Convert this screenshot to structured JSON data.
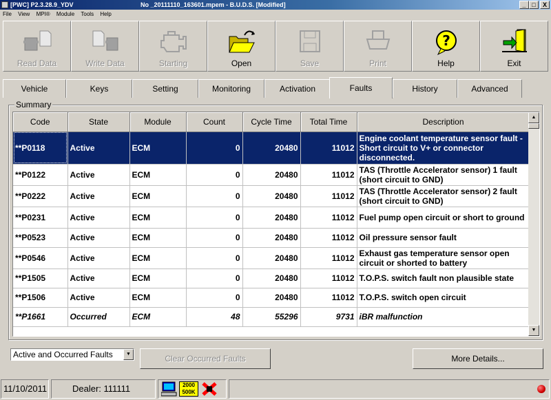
{
  "window": {
    "title_app": "[PWC] P2.3.28.9_YDV",
    "title_file": "No _20111110_163601.mpem - B.U.D.S. [Modified]",
    "controls": [
      "_",
      "□",
      "X"
    ]
  },
  "menu": [
    "File",
    "View",
    "MPI®",
    "Module",
    "Tools",
    "Help"
  ],
  "toolbar": [
    {
      "label": "Read Data",
      "icon": "read-data-icon",
      "enabled": false
    },
    {
      "label": "Write Data",
      "icon": "write-data-icon",
      "enabled": false
    },
    {
      "label": "Starting",
      "icon": "engine-icon",
      "enabled": false
    },
    {
      "label": "Open",
      "icon": "folder-open-icon",
      "enabled": true
    },
    {
      "label": "Save",
      "icon": "floppy-disk-icon",
      "enabled": false
    },
    {
      "label": "Print",
      "icon": "printer-icon",
      "enabled": false
    },
    {
      "label": "Help",
      "icon": "help-question-icon",
      "enabled": true
    },
    {
      "label": "Exit",
      "icon": "exit-door-icon",
      "enabled": true
    }
  ],
  "tabs": [
    "Vehicle",
    "Keys",
    "Setting",
    "Monitoring",
    "Activation",
    "Faults",
    "History",
    "Advanced"
  ],
  "active_tab": "Faults",
  "summary": {
    "legend": "Summary",
    "columns": [
      "Code",
      "State",
      "Module",
      "Count",
      "Cycle Time",
      "Total Time",
      "Description"
    ],
    "rows": [
      {
        "code": "**P0118",
        "state": "Active",
        "module": "ECM",
        "count": "0",
        "cycle": "20480",
        "total": "11012",
        "desc": "Engine coolant temperature sensor fault - Short circuit to V+ or connector disconnected."
      },
      {
        "code": "**P0122",
        "state": "Active",
        "module": "ECM",
        "count": "0",
        "cycle": "20480",
        "total": "11012",
        "desc": "TAS (Throttle Accelerator sensor) 1 fault (short circuit to GND)"
      },
      {
        "code": "**P0222",
        "state": "Active",
        "module": "ECM",
        "count": "0",
        "cycle": "20480",
        "total": "11012",
        "desc": "TAS (Throttle Accelerator sensor) 2 fault (short circuit to GND)"
      },
      {
        "code": "**P0231",
        "state": "Active",
        "module": "ECM",
        "count": "0",
        "cycle": "20480",
        "total": "11012",
        "desc": "Fuel pump open circuit or short to ground"
      },
      {
        "code": "**P0523",
        "state": "Active",
        "module": "ECM",
        "count": "0",
        "cycle": "20480",
        "total": "11012",
        "desc": "Oil pressure sensor fault"
      },
      {
        "code": "**P0546",
        "state": "Active",
        "module": "ECM",
        "count": "0",
        "cycle": "20480",
        "total": "11012",
        "desc": "Exhaust gas temperature sensor open circuit or shorted to battery"
      },
      {
        "code": "**P1505",
        "state": "Active",
        "module": "ECM",
        "count": "0",
        "cycle": "20480",
        "total": "11012",
        "desc": "T.O.P.S. switch fault non plausible state"
      },
      {
        "code": "**P1506",
        "state": "Active",
        "module": "ECM",
        "count": "0",
        "cycle": "20480",
        "total": "11012",
        "desc": "T.O.P.S. switch open circuit"
      },
      {
        "code": "**P1661",
        "state": "Occurred",
        "module": "ECM",
        "count": "48",
        "cycle": "55296",
        "total": "9731",
        "desc": "iBR malfunction"
      }
    ]
  },
  "filter": {
    "selected": "Active and Occurred Faults"
  },
  "buttons": {
    "clear": "Clear Occurred Faults",
    "more": "More Details..."
  },
  "status": {
    "date": "11/10/2011",
    "dealer": "Dealer: 111111",
    "baud_line1": "2000",
    "baud_line2": "500K"
  },
  "colors": {
    "selection": "#0a246a",
    "face": "#d4d0c8",
    "status_light": "#d00000"
  }
}
